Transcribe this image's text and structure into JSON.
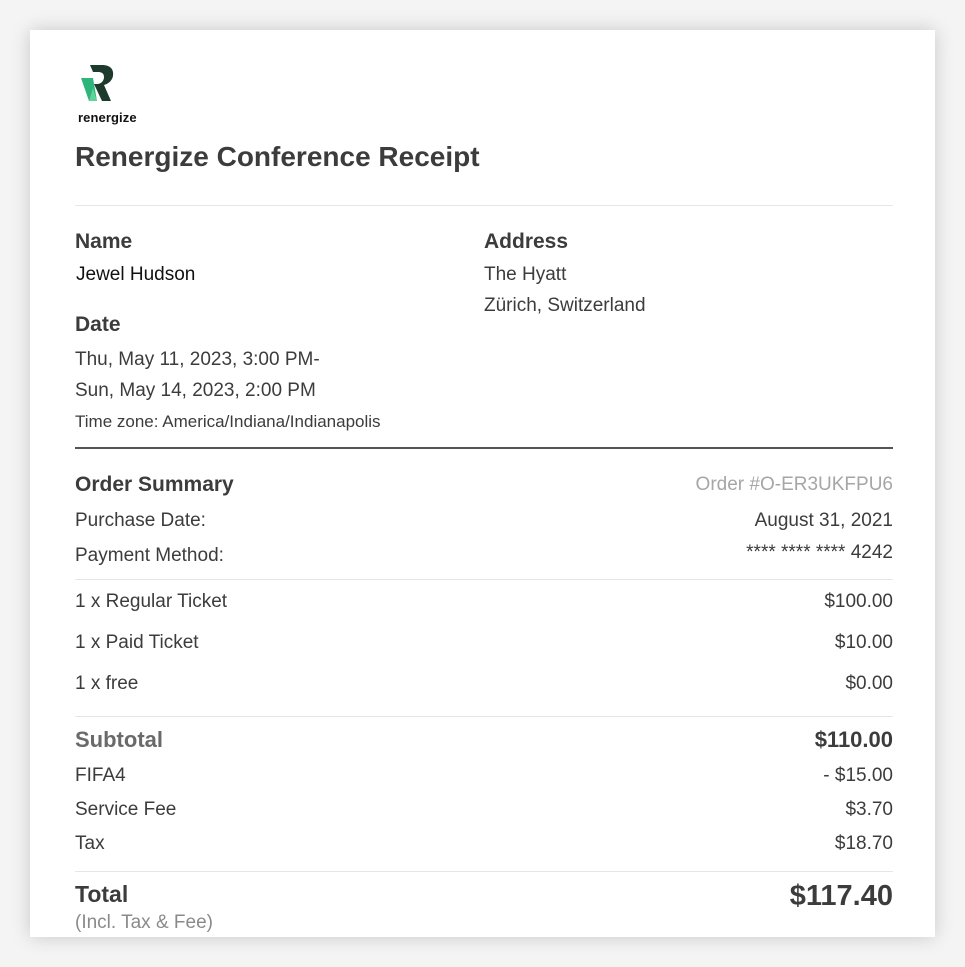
{
  "brand": {
    "logo_text": "renergize",
    "logo_icon": "renergize-r-logo",
    "colors": {
      "logo_dark": "#1e3a2c",
      "logo_green": "#2fb57a"
    }
  },
  "title": "Renergize Conference Receipt",
  "name_section": {
    "label": "Name",
    "value": "Jewel Hudson"
  },
  "address_section": {
    "label": "Address",
    "line1": "The Hyatt",
    "line2": "Zürich, Switzerland"
  },
  "date_section": {
    "label": "Date",
    "line1": "Thu, May 11, 2023,  3:00 PM-",
    "line2": "Sun, May 14, 2023,  2:00 PM",
    "timezone": "Time zone: America/Indiana/Indianapolis"
  },
  "order_summary": {
    "label": "Order Summary",
    "order_number": "Order #O-ER3UKFPU6",
    "purchase_date_label": "Purchase Date:",
    "purchase_date_value": "August 31, 2021",
    "payment_method_label": "Payment Method:",
    "payment_method_value": "**** **** **** 4242"
  },
  "items": [
    {
      "label": "1 x Regular Ticket",
      "amount": "$100.00"
    },
    {
      "label": "1 x Paid Ticket",
      "amount": "$10.00"
    },
    {
      "label": "1 x free",
      "amount": "$0.00"
    }
  ],
  "totals": {
    "subtotal_label": "Subtotal",
    "subtotal_value": "$110.00",
    "discount_label": "FIFA4",
    "discount_value": "- $15.00",
    "service_fee_label": "Service Fee",
    "service_fee_value": "$3.70",
    "tax_label": "Tax",
    "tax_value": "$18.70",
    "total_label": "Total",
    "total_note": "(Incl. Tax & Fee)",
    "total_value": "$117.40"
  }
}
